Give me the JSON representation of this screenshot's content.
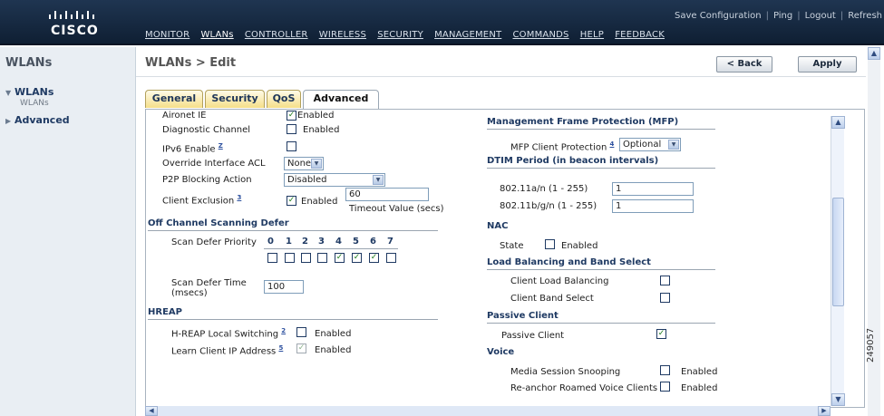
{
  "brand": {
    "logo_word": "CISCO"
  },
  "utility_links": [
    "Save Configuration",
    "Ping",
    "Logout",
    "Refresh"
  ],
  "nav": [
    "MONITOR",
    "WLANs",
    "CONTROLLER",
    "WIRELESS",
    "SECURITY",
    "MANAGEMENT",
    "COMMANDS",
    "HELP",
    "FEEDBACK"
  ],
  "active_nav": "WLANs",
  "sidebar": {
    "title": "WLANs",
    "items": [
      {
        "label": "WLANs",
        "expanded": true,
        "sub": "WLANs"
      },
      {
        "label": "Advanced",
        "expanded": false
      }
    ]
  },
  "page": {
    "title": "WLANs > Edit",
    "back": "< Back",
    "apply": "Apply"
  },
  "tabs": [
    "General",
    "Security",
    "QoS",
    "Advanced"
  ],
  "active_tab": "Advanced",
  "left": {
    "aironet_ie": {
      "label": "Aironet IE",
      "checked": true,
      "text": "Enabled"
    },
    "diagnostic_channel": {
      "label": "Diagnostic Channel",
      "checked": false,
      "text": "Enabled"
    },
    "ipv6": {
      "label": "IPv6 Enable",
      "sup": "Z",
      "checked": false
    },
    "override_acl": {
      "label": "Override Interface ACL",
      "value": "None"
    },
    "p2p": {
      "label": "P2P Blocking Action",
      "value": "Disabled"
    },
    "client_exclusion": {
      "label": "Client Exclusion",
      "sup": "3",
      "checked": true,
      "text": "Enabled",
      "timeout": "60",
      "timeout_label": "Timeout Value (secs)"
    },
    "off_channel": {
      "title": "Off Channel Scanning Defer",
      "priority_label": "Scan Defer Priority",
      "priorities": [
        "0",
        "1",
        "2",
        "3",
        "4",
        "5",
        "6",
        "7"
      ],
      "checked": [
        false,
        false,
        false,
        false,
        true,
        true,
        true,
        false
      ],
      "defer_time_label": "Scan Defer Time",
      "defer_time_unit": "(msecs)",
      "defer_time": "100"
    },
    "hreap": {
      "title": "HREAP",
      "local_switching": {
        "label": "H-REAP Local Switching",
        "sup": "2",
        "checked": false,
        "text": "Enabled"
      },
      "learn_ip": {
        "label": "Learn Client IP Address",
        "sup": "5",
        "checked": true,
        "disabled": true,
        "text": "Enabled"
      }
    }
  },
  "right": {
    "mfp": {
      "title": "Management Frame Protection (MFP)",
      "label": "MFP Client Protection",
      "sup": "4",
      "value": "Optional"
    },
    "dtim": {
      "title": "DTIM Period (in beacon intervals)",
      "a_label": "802.11a/n (1 - 255)",
      "a_value": "1",
      "b_label": "802.11b/g/n (1 - 255)",
      "b_value": "1"
    },
    "nac": {
      "title": "NAC",
      "state_label": "State",
      "checked": false,
      "text": "Enabled"
    },
    "load_balancing": {
      "title": "Load Balancing and Band Select",
      "clb_label": "Client Load Balancing",
      "clb_checked": false,
      "cbs_label": "Client Band Select",
      "cbs_checked": false
    },
    "passive": {
      "title": "Passive Client",
      "label": "Passive Client",
      "checked": true
    },
    "voice": {
      "title": "Voice",
      "mss_label": "Media Session Snooping",
      "mss_checked": false,
      "mss_text": "Enabled",
      "reanchor_label": "Re-anchor Roamed Voice Clients",
      "reanchor_checked": false,
      "reanchor_text": "Enabled"
    }
  },
  "watermark": "249057"
}
